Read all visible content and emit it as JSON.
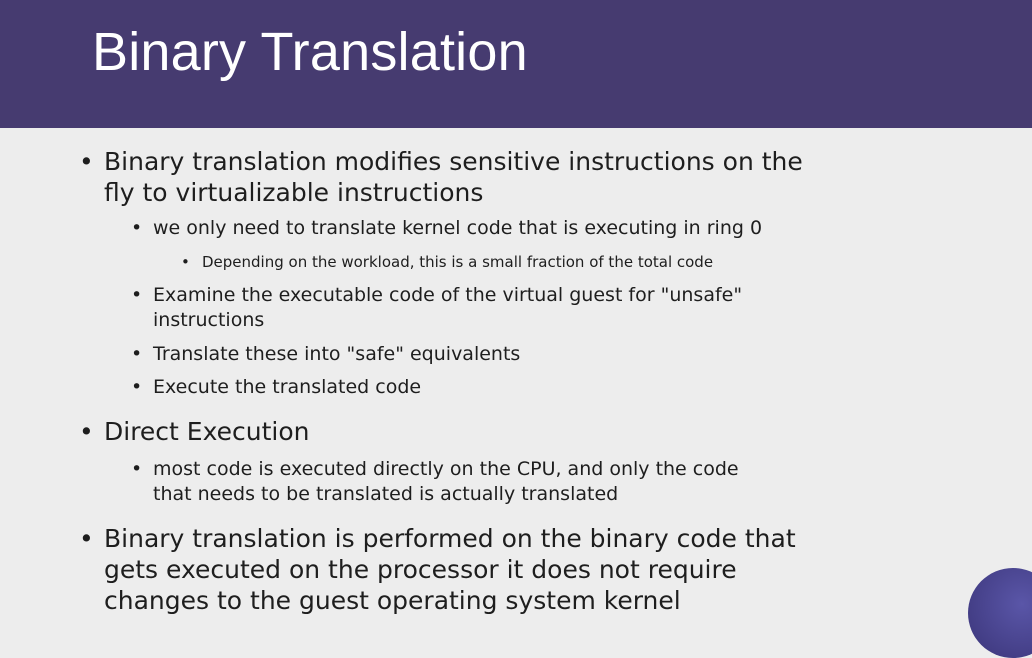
{
  "slide": {
    "title": "Binary Translation",
    "bullet_glyph": "•",
    "bullets": {
      "b1": {
        "line1": "Binary translation modifies sensitive instructions on the",
        "line2": "fly to virtualizable instructions"
      },
      "b1_1": "we only need to translate kernel code that is executing in ring 0",
      "b1_1_1": "Depending on the workload, this is a small fraction of the total code",
      "b1_2": {
        "line1": "Examine the executable code of the virtual guest for \"unsafe\"",
        "line2": "instructions"
      },
      "b1_3": "Translate these into \"safe\" equivalents",
      "b1_4": "Execute the translated code",
      "b2": "Direct Execution",
      "b2_1": {
        "line1": "most code is executed directly on the CPU, and only the code",
        "line2": "that needs to be translated is actually translated"
      },
      "b3": {
        "line1": "Binary translation is performed on the binary code that",
        "line2": "gets executed on the processor it does not require",
        "line3": "changes to the guest operating system kernel"
      }
    },
    "colors": {
      "header": "#463b70",
      "background": "#ededed",
      "text": "#1e1e1e",
      "title_text": "#ffffff"
    }
  }
}
